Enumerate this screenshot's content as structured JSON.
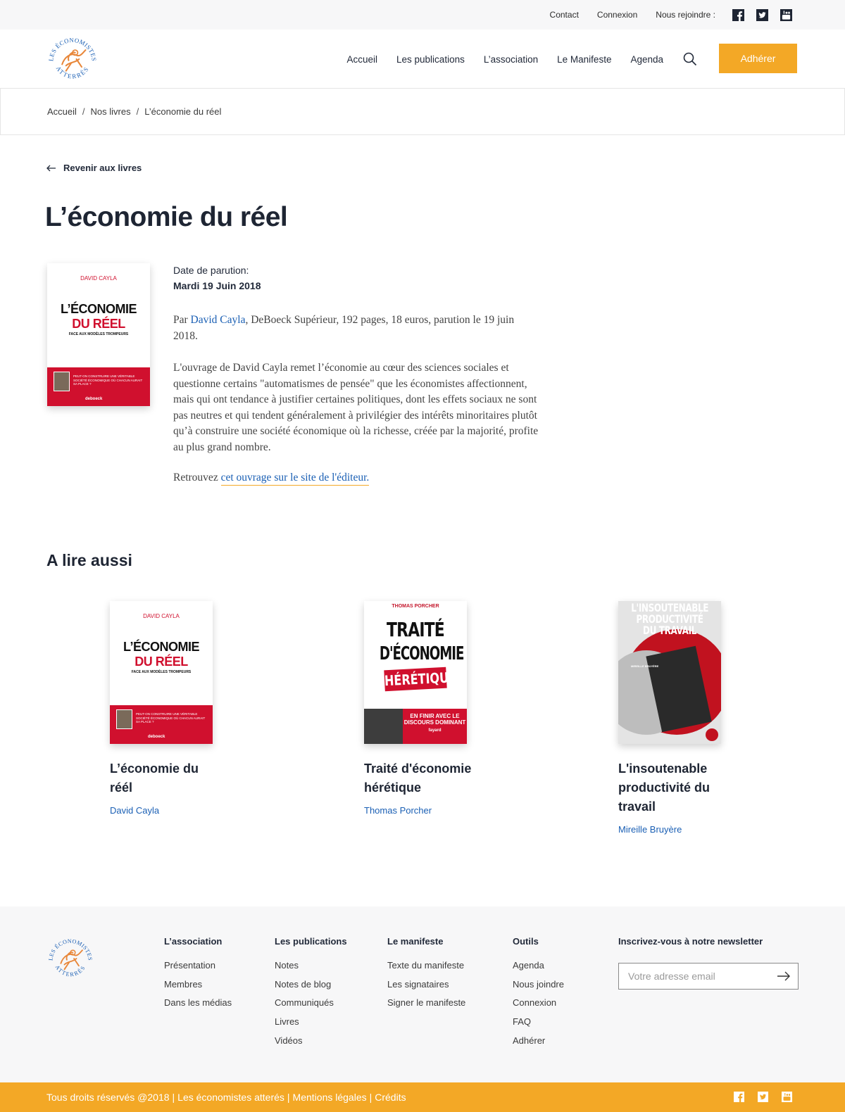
{
  "topbar": {
    "contact": "Contact",
    "login": "Connexion",
    "join": "Nous rejoindre :",
    "social": [
      "facebook-icon",
      "twitter-icon",
      "youtube-icon"
    ]
  },
  "header": {
    "logo_text": "LES ÉCONOMISTES ATTERRÉS",
    "nav": [
      "Accueil",
      "Les publications",
      "L’association",
      "Le Manifeste",
      "Agenda"
    ],
    "cta": "Adhérer",
    "accent_color": "#f3a826"
  },
  "breadcrumb": {
    "items": [
      "Accueil",
      "Nos livres",
      "L’économie du réel"
    ],
    "separator": "/"
  },
  "back_link": "Revenir aux livres",
  "book": {
    "title": "L’économie du réel",
    "date_label": "Date de parution:",
    "date_value": "Mardi 19 Juin 2018",
    "p1_prefix": "Par ",
    "p1_author": "David Cayla",
    "p1_rest": ", DeBoeck Supérieur, 192 pages, 18 euros, parution le 19 juin 2018.",
    "p2": "L'ouvrage de David Cayla remet l’économie au cœur des sciences sociales et questionne certains \"automatismes de pensée\" que les économistes affectionnent, mais qui ont tendance à justifier certaines politiques, dont les effets sociaux ne sont pas neutres et qui tendent généralement à privilégier des intérêts minoritaires plutôt qu’à construire une société économique où la richesse, créée par la majorité, profite au plus grand nombre.",
    "p3_prefix": "Retrouvez ",
    "p3_link": "cet ouvrage sur le site de l'éditeur.",
    "cover": {
      "author": "DAVID CAYLA",
      "line1": "L’ÉCONOMIE",
      "line2": "DU RÉEL",
      "line3": "FACE AUX MODÈLES TROMPEURS",
      "band": "PEUT-ON CONSTRUIRE UNE VÉRITABLE SOCIÉTÉ ÉCONOMIQUE OÙ CHACUN AURAIT SA PLACE ?",
      "publisher": "deboeck"
    }
  },
  "also": {
    "heading": "A lire aussi",
    "cards": [
      {
        "title": "L’économie du réél",
        "author": "David Cayla"
      },
      {
        "title": "Traité d'économie hérétique",
        "author": "Thomas Porcher",
        "cover": {
          "author": "THOMAS PORCHER",
          "a": "TRAITÉ",
          "b": "D'ÉCONOMIE",
          "c": "HÉRÉTIQUE",
          "band": "EN FINIR AVEC LE DISCOURS DOMINANT",
          "publisher": "fayard"
        }
      },
      {
        "title": "L'insoutenable productivité du travail",
        "author": "Mireille Bruyère",
        "cover": {
          "title": "L'INSOUTENABLE PRODUCTIVITÉ DU TRAVAIL",
          "author": "MIREILLE BRUYÈRE"
        }
      }
    ]
  },
  "footer": {
    "logo_text": "LES ÉCONOMISTES ATTERRÉS",
    "columns": [
      {
        "heading": "L’association",
        "links": [
          "Présentation",
          "Membres",
          "Dans les médias"
        ]
      },
      {
        "heading": "Les publications",
        "links": [
          "Notes",
          "Notes de blog",
          "Communiqués",
          "Livres",
          "Vidéos"
        ]
      },
      {
        "heading": "Le manifeste",
        "links": [
          "Texte du manifeste",
          "Les signataires",
          "Signer le manifeste"
        ]
      },
      {
        "heading": "Outils",
        "links": [
          "Agenda",
          "Nous joindre",
          "Connexion",
          "FAQ",
          "Adhérer"
        ]
      }
    ],
    "newsletter_heading": "Inscrivez-vous à notre newsletter",
    "email_placeholder": "Votre adresse email"
  },
  "bottombar": {
    "copyright": "Tous droits réservés @2018",
    "name": "Les économistes atterés",
    "legal": "Mentions légales",
    "credits": "Crédits",
    "separator": "|"
  }
}
